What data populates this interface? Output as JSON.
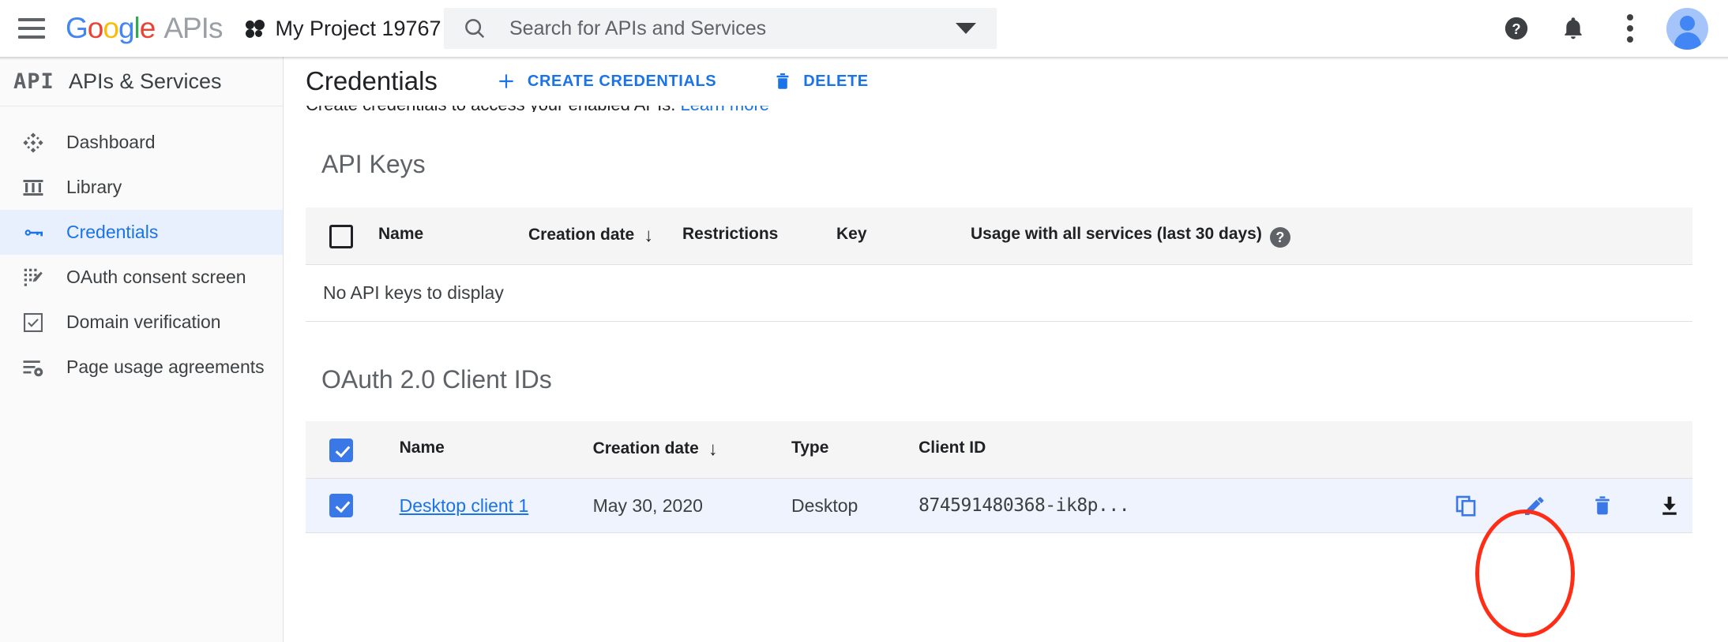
{
  "topbar": {
    "menu_icon": "hamburger-icon",
    "brand": {
      "g": "G",
      "o1": "o",
      "o2": "o",
      "g2": "g",
      "l": "l",
      "e": "e",
      "suffix": "APIs"
    },
    "project_name": "My Project 19767",
    "search": {
      "placeholder": "Search for APIs and Services",
      "icon": "search-icon"
    },
    "help_icon": "help-icon",
    "notifications_icon": "bell-icon",
    "more_icon": "kebab-menu-icon",
    "account_icon": "avatar-icon"
  },
  "sidebar": {
    "logo_text": "API",
    "title": "APIs & Services",
    "items": [
      {
        "label": "Dashboard",
        "icon": "dashboard-icon",
        "active": false
      },
      {
        "label": "Library",
        "icon": "library-icon",
        "active": false
      },
      {
        "label": "Credentials",
        "icon": "key-icon",
        "active": true
      },
      {
        "label": "OAuth consent screen",
        "icon": "consent-screen-icon",
        "active": false
      },
      {
        "label": "Domain verification",
        "icon": "checkbox-verified-icon",
        "active": false
      },
      {
        "label": "Page usage agreements",
        "icon": "agreements-icon",
        "active": false
      }
    ]
  },
  "main": {
    "page_title": "Credentials",
    "create_button": "CREATE CREDENTIALS",
    "delete_button": "DELETE",
    "subtitle": "Create credentials to access your enabled APIs.",
    "subtitle_link": "Learn more",
    "api_keys": {
      "section_title": "API Keys",
      "columns": [
        "Name",
        "Creation date",
        "Restrictions",
        "Key",
        "Usage with all services (last 30 days)"
      ],
      "sorted_column": "Creation date",
      "sort_direction": "desc",
      "header_checkbox_checked": false,
      "empty_message": "No API keys to display",
      "rows": []
    },
    "oauth_clients": {
      "section_title": "OAuth 2.0 Client IDs",
      "columns": [
        "Name",
        "Creation date",
        "Type",
        "Client ID"
      ],
      "sorted_column": "Creation date",
      "sort_direction": "desc",
      "header_checkbox_checked": true,
      "rows": [
        {
          "checked": true,
          "name": "Desktop client 1",
          "creation_date": "May 30, 2020",
          "type": "Desktop",
          "client_id": "874591480368-ik8p...",
          "actions": [
            "copy-icon",
            "edit-icon",
            "delete-icon",
            "download-icon"
          ]
        }
      ]
    }
  },
  "annotation": {
    "shape": "ellipse",
    "color": "#ff2d16",
    "target": "edit-icon"
  }
}
